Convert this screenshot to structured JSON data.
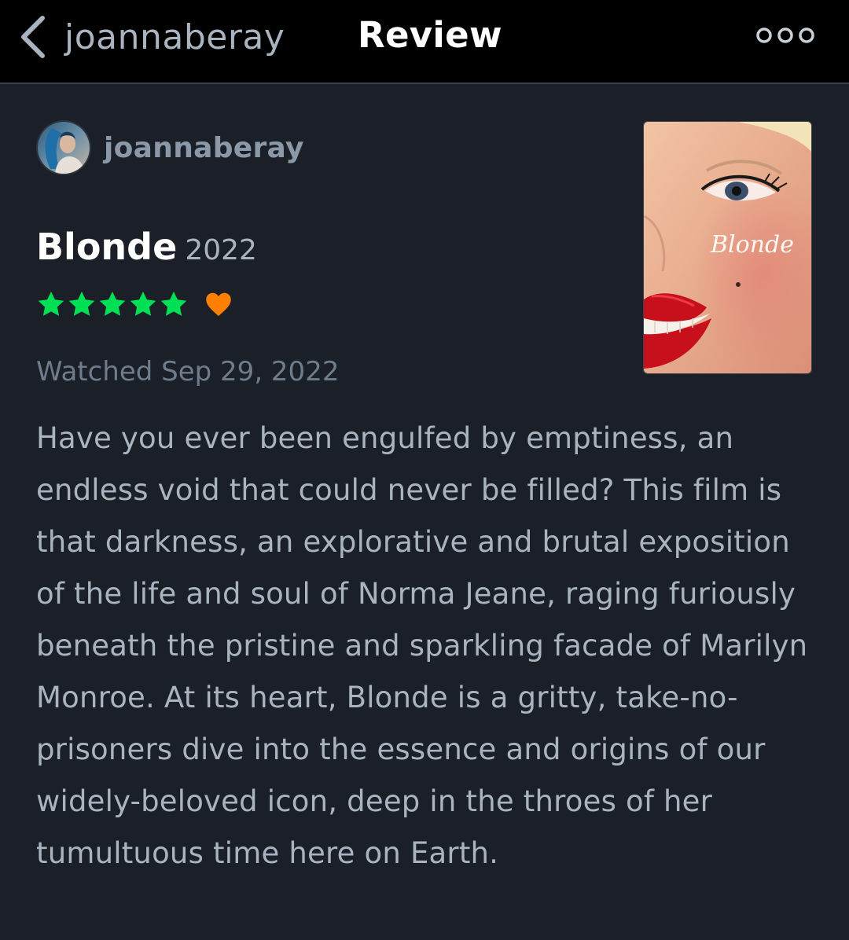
{
  "nav": {
    "back_label": "joannaberay",
    "title": "Review",
    "back_icon": "chevron-left-icon",
    "more_icon": "more-dots-icon"
  },
  "review": {
    "reviewer_name": "joannaberay",
    "film_title": "Blonde",
    "film_year": "2022",
    "rating_stars": 5,
    "liked": true,
    "watched": "Watched Sep 29, 2022",
    "poster_title": "Blonde",
    "text": "Have you ever been engulfed by emptiness, an endless void that could never be filled? This film is that darkness, an explorative and brutal exposition of the life and soul of Norma Jeane, raging furiously beneath the pristine and sparkling facade of Marilyn Monroe. At its heart, Blonde is a gritty, take-no-prisoners dive into the essence and origins of our widely-beloved icon, deep in the throes of her tumultuous time here on Earth."
  },
  "colors": {
    "background": "#1b2028",
    "navbar": "#000000",
    "star": "#00e054",
    "heart": "#ff8000",
    "text": "#a9b4c0",
    "muted": "#6e7c8c"
  }
}
